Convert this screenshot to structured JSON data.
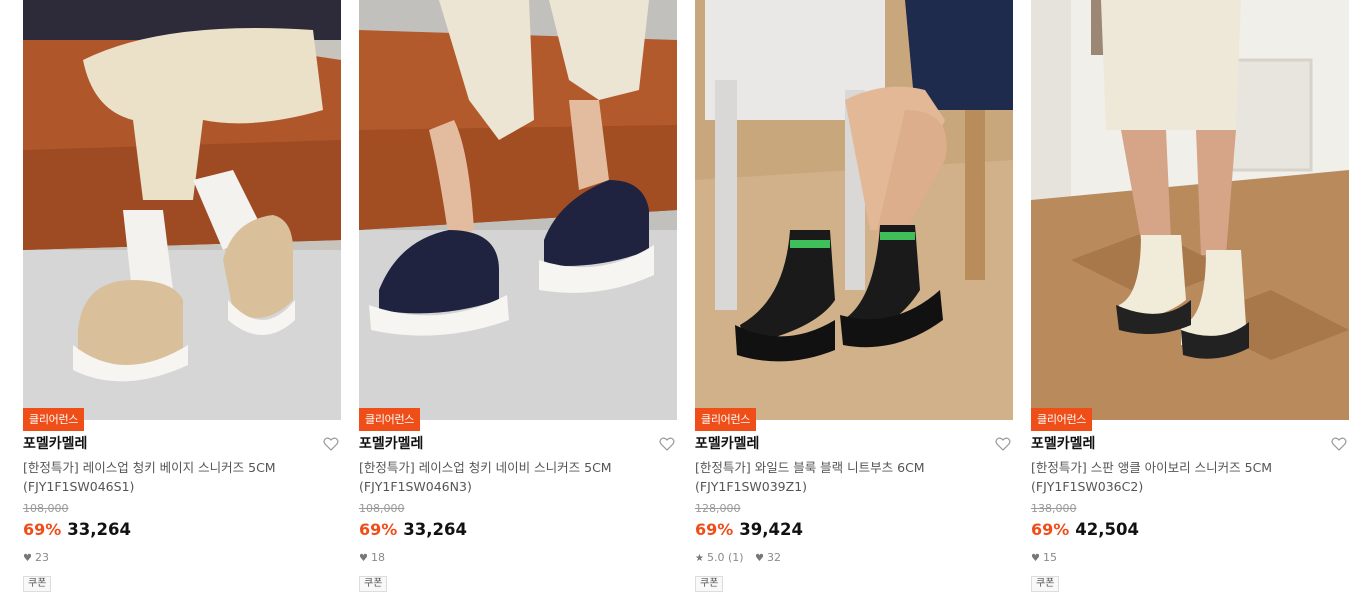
{
  "products": [
    {
      "badge": "클리어런스",
      "brand": "포멜카멜레",
      "name_line1": "[한정특가] 레이스업 청키 베이지 스니커즈 5CM",
      "name_line2": "(FJY1F1SW046S1)",
      "original_price": "108,000",
      "discount": "69%",
      "sale_price": "33,264",
      "rating": "",
      "likes": "23",
      "coupon": "쿠폰",
      "image_icon": "beige-sneakers-photo"
    },
    {
      "badge": "클리어런스",
      "brand": "포멜카멜레",
      "name_line1": "[한정특가] 레이스업 청키 네이비 스니커즈 5CM",
      "name_line2": "(FJY1F1SW046N3)",
      "original_price": "108,000",
      "discount": "69%",
      "sale_price": "33,264",
      "rating": "",
      "likes": "18",
      "coupon": "쿠폰",
      "image_icon": "navy-sneakers-photo"
    },
    {
      "badge": "클리어런스",
      "brand": "포멜카멜레",
      "name_line1": "[한정특가] 와일드 블룩 블랙 니트부츠 6CM",
      "name_line2": "(FJY1F1SW039Z1)",
      "original_price": "128,000",
      "discount": "69%",
      "sale_price": "39,424",
      "rating": "5.0 (1)",
      "likes": "32",
      "coupon": "쿠폰",
      "image_icon": "black-knit-boots-photo"
    },
    {
      "badge": "클리어런스",
      "brand": "포멜카멜레",
      "name_line1": "[한정특가] 스판 앵클 아이보리 스니커즈 5CM",
      "name_line2": "(FJY1F1SW036C2)",
      "original_price": "138,000",
      "discount": "69%",
      "sale_price": "42,504",
      "rating": "",
      "likes": "15",
      "coupon": "쿠폰",
      "image_icon": "ivory-ankle-boots-photo"
    }
  ],
  "colors": {
    "accent": "#f04e19",
    "text": "#222222",
    "muted": "#8a8a8a"
  }
}
